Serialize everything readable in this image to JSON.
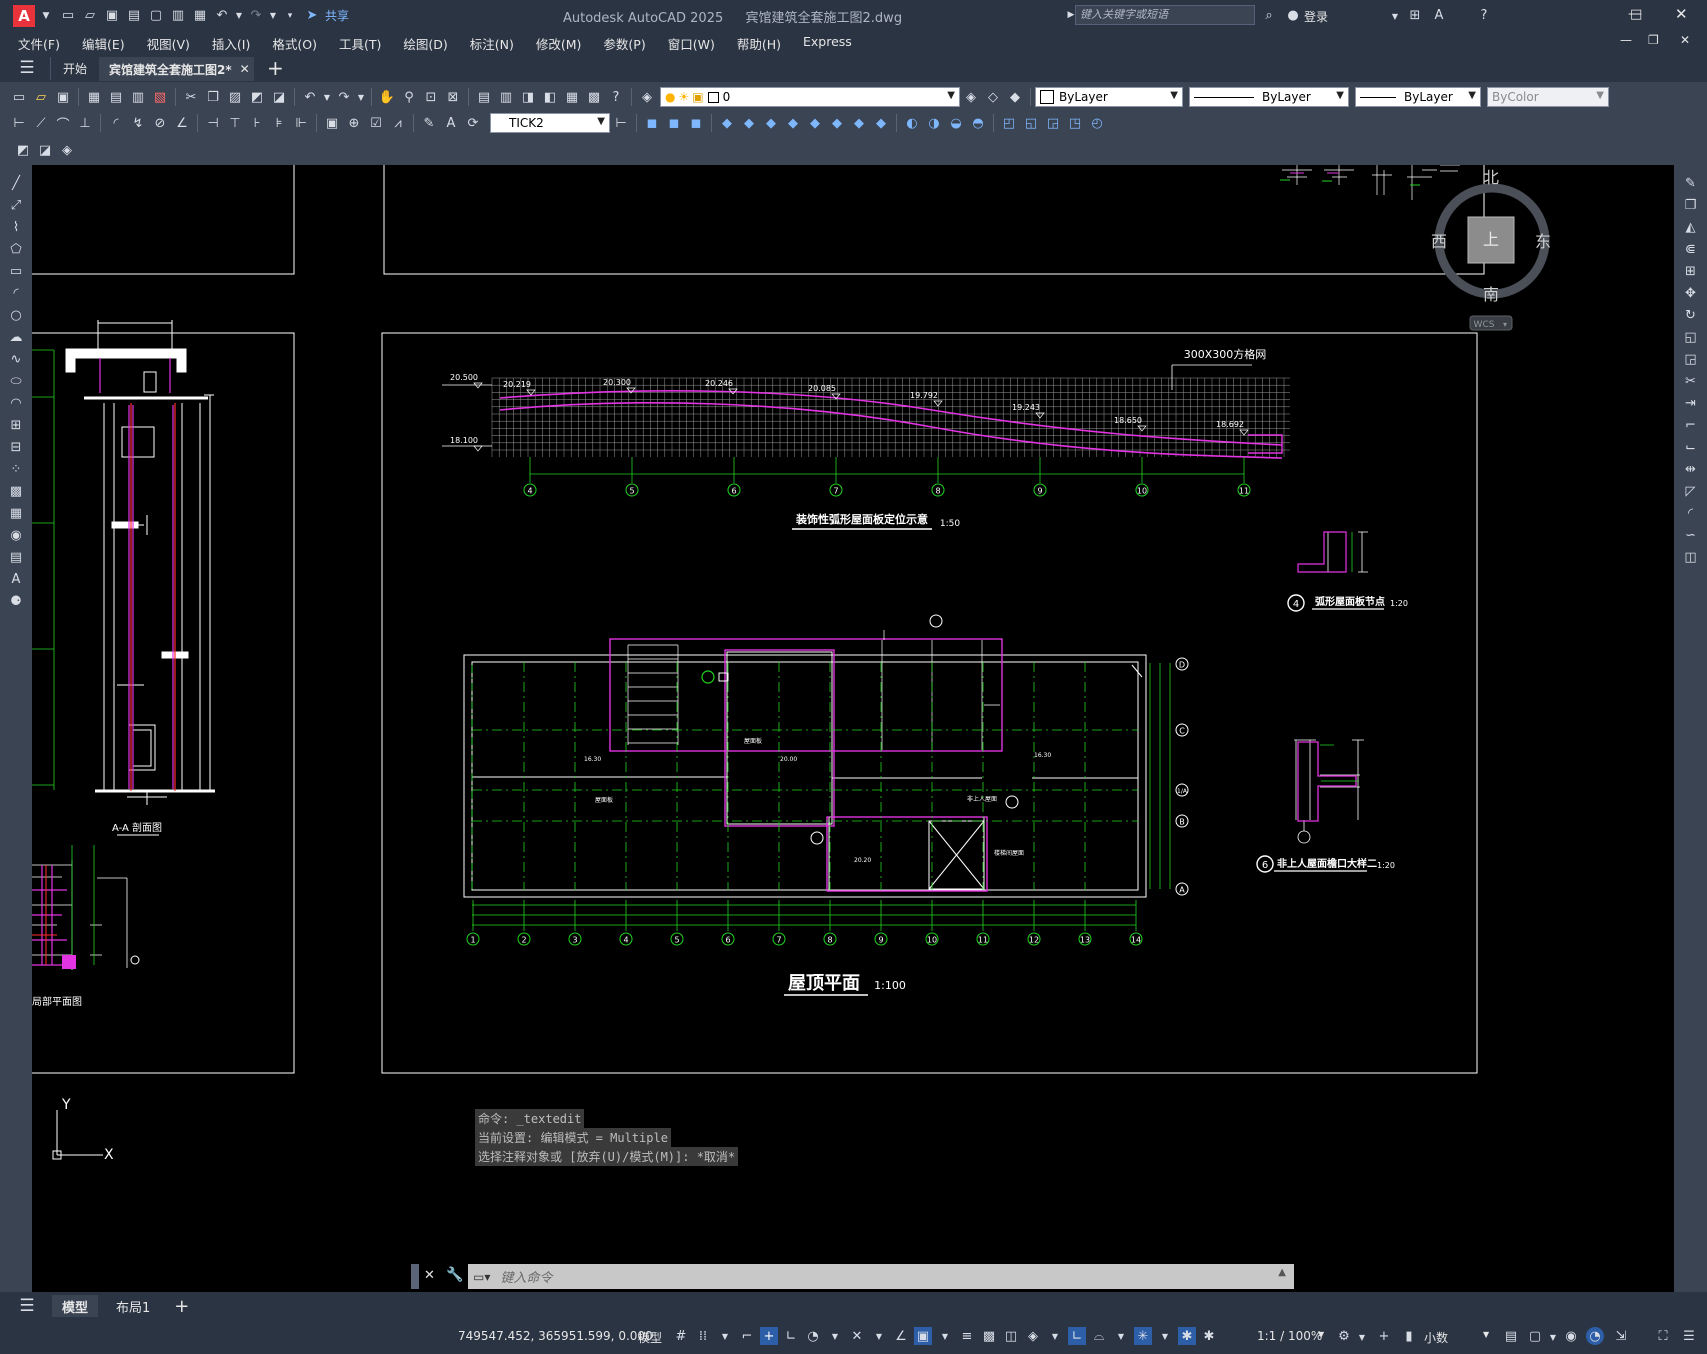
{
  "app": {
    "title": "Autodesk AutoCAD 2025",
    "filename": "宾馆建筑全套施工图2.dwg",
    "share_label": "共享",
    "search_placeholder": "键入关键字或短语",
    "login_label": "登录",
    "logo_letter": "A"
  },
  "menu": [
    "文件(F)",
    "编辑(E)",
    "视图(V)",
    "插入(I)",
    "格式(O)",
    "工具(T)",
    "绘图(D)",
    "标注(N)",
    "修改(M)",
    "参数(P)",
    "窗口(W)",
    "帮助(H)",
    "Express"
  ],
  "tabs": [
    {
      "label": "开始",
      "active": false
    },
    {
      "label": "宾馆建筑全套施工图2*",
      "active": true
    }
  ],
  "toolbar": {
    "layer_value": "0",
    "color_value": "ByLayer",
    "linetype_value": "ByLayer",
    "lineweight_value": "ByLayer",
    "plotstyle_value": "ByColor",
    "dimstyle_value": "TICK2"
  },
  "viewcube": {
    "north": "北",
    "south": "南",
    "east": "东",
    "west": "西",
    "top": "上",
    "wcs": "WCS"
  },
  "drawing": {
    "section_title": "A-A 剖面图",
    "partial_plan_title": "局部平面图",
    "arc_title": "装饰性弧形屋面板定位示意",
    "arc_scale": "1:50",
    "grid_note": "300X300方格网",
    "arc_elevations": [
      "20.500",
      "20.219",
      "20.300",
      "20.246",
      "20.085",
      "19.792",
      "19.243",
      "18.650",
      "18.692",
      "18.100"
    ],
    "arc_axes": [
      "4",
      "5",
      "6",
      "7",
      "8",
      "9",
      "10",
      "11"
    ],
    "roof_title": "屋顶平面",
    "roof_scale": "1:100",
    "roof_axes_x": [
      "1",
      "2",
      "3",
      "4",
      "5",
      "6",
      "7",
      "8",
      "9",
      "10",
      "11",
      "12",
      "13",
      "14"
    ],
    "roof_axes_y": [
      "D",
      "C",
      "B",
      "A"
    ],
    "roof_axis_1a": "1/A",
    "detail4_num": "4",
    "detail4_title": "弧形屋面板节点",
    "detail4_scale": "1:20",
    "detail6_num": "6",
    "detail6_title": "非上人屋面檐口大样二",
    "detail6_scale": "1:20",
    "ucs_x": "X",
    "ucs_y": "Y"
  },
  "command": {
    "history": [
      "命令: _textedit",
      "当前设置: 编辑模式 = Multiple",
      "选择注释对象或 [放弃(U)/模式(M)]: *取消*"
    ],
    "placeholder": "键入命令"
  },
  "layout_tabs": [
    "模型",
    "布局1"
  ],
  "status": {
    "coords": "749547.452, 365951.599, 0.000",
    "space": "模型",
    "scale": "1:1 / 100%",
    "units": "小数"
  },
  "colors": {
    "accent": "#e8323c",
    "canvas": "#000000",
    "magenta": "#e234e2",
    "green": "#22d322",
    "white": "#ffffff"
  }
}
